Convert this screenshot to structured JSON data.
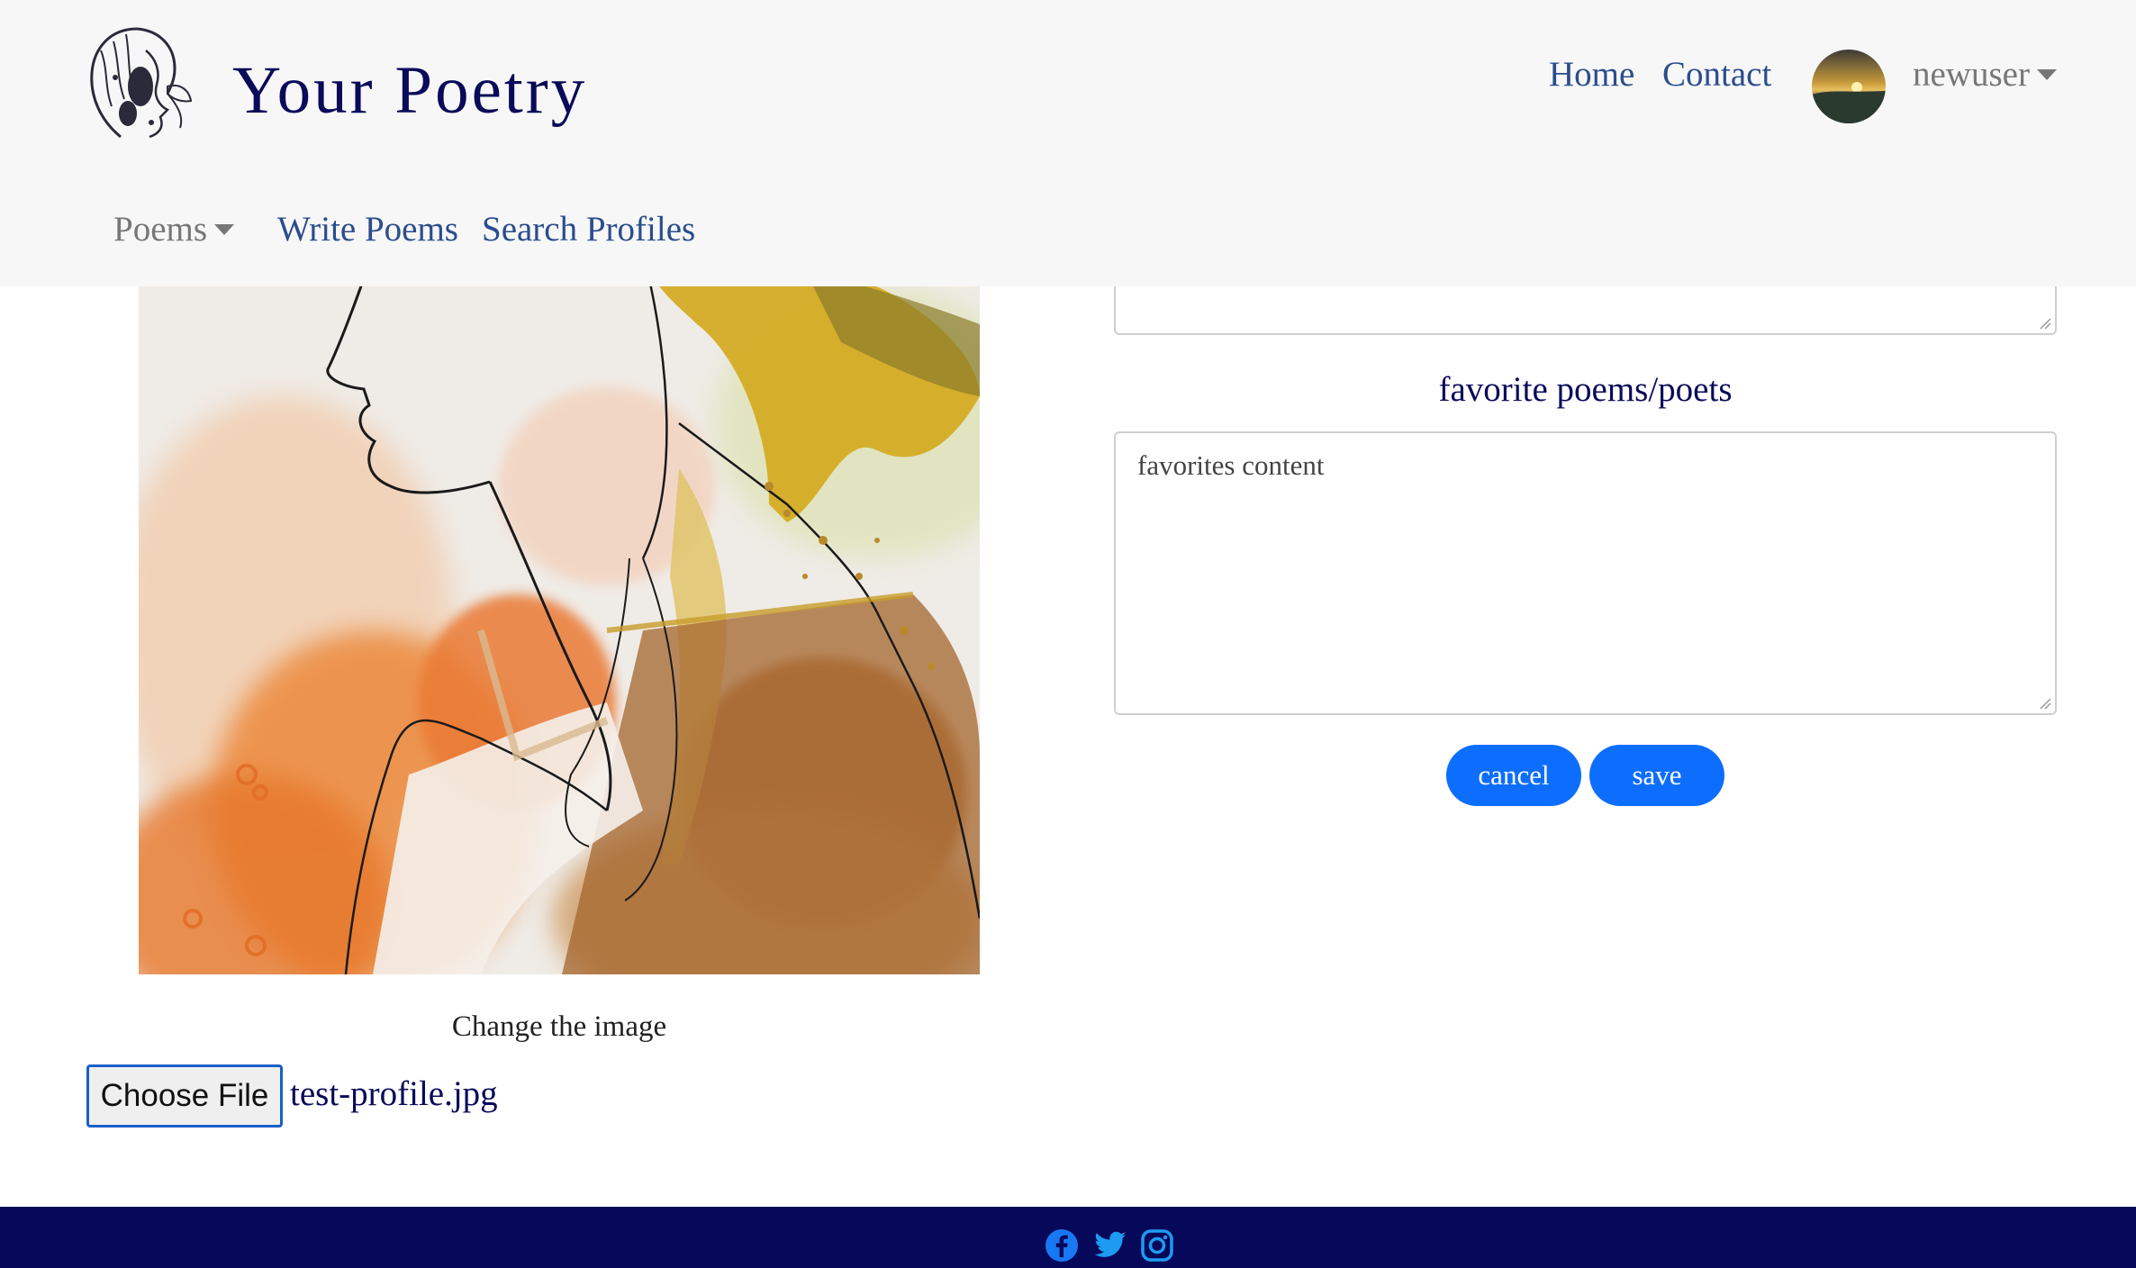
{
  "header": {
    "brand": "Your Poetry",
    "logo_icon": "woman-portrait-logo",
    "nav_top": {
      "home": "Home",
      "contact": "Contact"
    },
    "user": {
      "name": "newuser",
      "avatar_icon": "sunset-avatar"
    },
    "nav_bottom": {
      "poems": "Poems",
      "write": "Write Poems",
      "search": "Search Profiles"
    }
  },
  "profile": {
    "image_icon": "watercolor-portrait-image",
    "change_image_label": "Change the image",
    "choose_file_label": "Choose File",
    "file_name": "test-profile.jpg"
  },
  "form": {
    "favorites_heading": "favorite poems/poets",
    "favorites_value": "favorites content",
    "cancel_label": "cancel",
    "save_label": "save"
  },
  "footer": {
    "icons": [
      "facebook-icon",
      "twitter-icon",
      "instagram-icon"
    ]
  },
  "colors": {
    "brand": "#0a0a5a",
    "link": "#2b4d8c",
    "primary": "#0d6efd",
    "footer": "#06085a",
    "header_bg": "#f7f7f7"
  }
}
